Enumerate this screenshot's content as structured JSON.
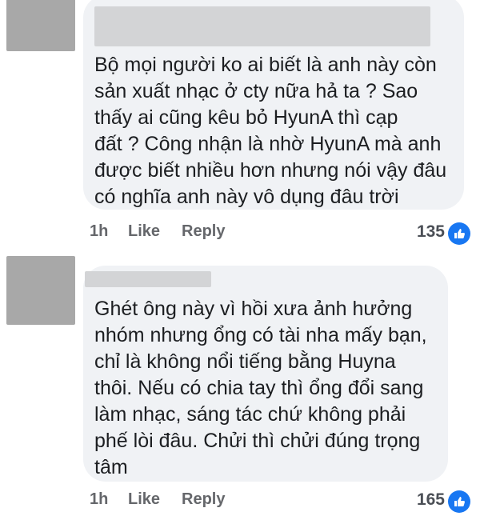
{
  "comments": [
    {
      "text": "Bộ mọi người ko ai biết là anh này còn\nsản xuất nhạc ở cty nữa hả ta ? Sao\nthấy ai cũng kêu bỏ HyunA thì cạp\nđất ? Công nhận là nhờ HyunA mà anh\nđược biết nhiều hơn nhưng nói vậy đâu\ncó nghĩa anh này vô dụng đâu trời",
      "time": "1h",
      "like_label": "Like",
      "reply_label": "Reply",
      "reaction_count": "135",
      "reaction_icon": "like-thumb-icon"
    },
    {
      "text": "Ghét ông này vì hồi xưa ảnh hưởng\nnhóm nhưng ổng có tài nha mấy bạn,\nchỉ là không nổi tiếng bằng Huyna\nthôi. Nếu có chia tay thì ổng đổi sang\nlàm nhạc, sáng tác chứ không phải\nphế lòi đâu. Chửi thì chửi đúng trọng\ntâm",
      "time": "1h",
      "like_label": "Like",
      "reply_label": "Reply",
      "reaction_count": "165",
      "reaction_icon": "like-thumb-icon"
    }
  ],
  "colors": {
    "bubble": "#f0f2f5",
    "name_redaction": "#d3d4d6",
    "avatar_redaction": "#a8a8a8",
    "meta_text": "#65676b",
    "like_badge": "#1877f2"
  }
}
